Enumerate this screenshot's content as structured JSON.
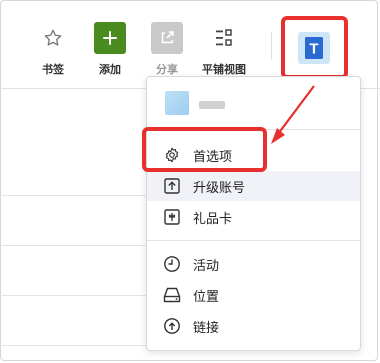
{
  "toolbar": {
    "bookmarks_label": "书签",
    "add_label": "添加",
    "share_label": "分享",
    "tile_view_label": "平铺视图"
  },
  "avatar": {
    "letter": "T"
  },
  "menu": {
    "items": [
      {
        "label": "首选项",
        "icon": "gear-icon"
      },
      {
        "label": "升级账号",
        "icon": "upload-icon"
      },
      {
        "label": "礼品卡",
        "icon": "gift-card-icon"
      },
      {
        "label": "活动",
        "icon": "clock-icon"
      },
      {
        "label": "位置",
        "icon": "drive-icon"
      },
      {
        "label": "链接",
        "icon": "cloud-upload-icon"
      }
    ]
  },
  "colors": {
    "add_button": "#4a8b1f",
    "annotation_red": "#e8302f",
    "avatar_tile": "#2a6bd1"
  }
}
